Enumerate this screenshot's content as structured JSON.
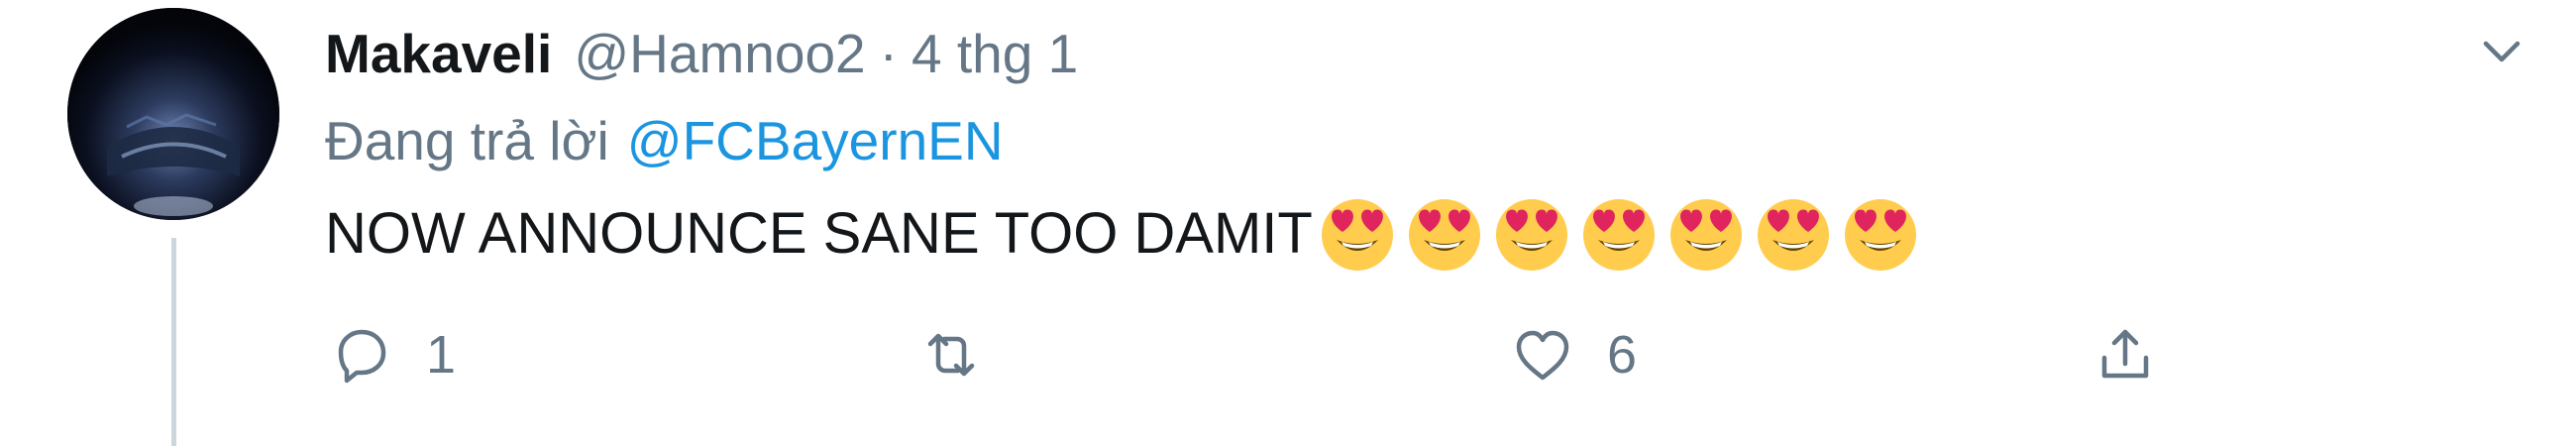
{
  "tweet": {
    "author_name": "Makaveli",
    "handle": "@Hamnoo2",
    "separator": "·",
    "time": "4 thg 1",
    "reply_prefix": "Đang trả lời",
    "reply_to": "@FCBayernEN",
    "text": "NOW ANNOUNCE SANE TOO DAMIT",
    "emoji": "heart-eyes-face",
    "emoji_count": 7
  },
  "actions": {
    "reply_count": "1",
    "retweet_count": "",
    "like_count": "6"
  },
  "colors": {
    "text": "#14171a",
    "muted": "#657786",
    "link": "#1b95e0",
    "thread_line": "#ccd6dd",
    "emoji_face": "#ffcc4d",
    "emoji_heart": "#e0245e"
  }
}
